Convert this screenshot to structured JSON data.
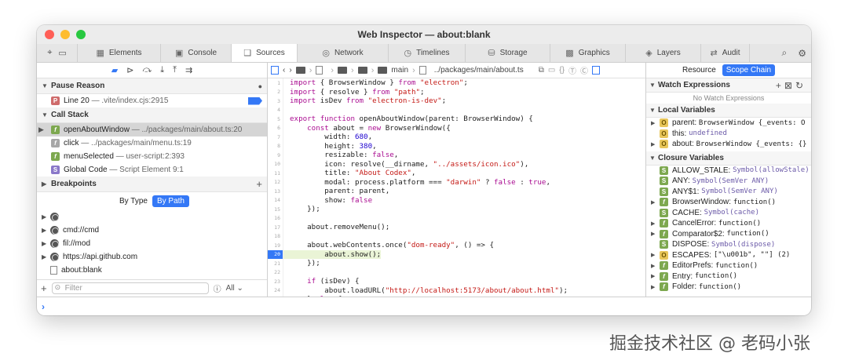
{
  "window": {
    "title": "Web Inspector — about:blank",
    "light_colors": [
      "#ff5f57",
      "#febc2e",
      "#28c840"
    ]
  },
  "tabs": [
    {
      "label": "Elements",
      "icon": "elements-icon",
      "glyph": "▦",
      "w": 106
    },
    {
      "label": "Console",
      "icon": "console-icon",
      "glyph": "▣",
      "w": 90
    },
    {
      "label": "Sources",
      "icon": "sources-icon",
      "glyph": "❑",
      "w": 84,
      "active": true
    },
    {
      "label": "Network",
      "icon": "network-icon",
      "glyph": "◎",
      "w": 116
    },
    {
      "label": "Timelines",
      "icon": "timelines-icon",
      "glyph": "◷",
      "w": 98
    },
    {
      "label": "Storage",
      "icon": "storage-icon",
      "glyph": "⛁",
      "w": 108
    },
    {
      "label": "Graphics",
      "icon": "graphics-icon",
      "glyph": "▩",
      "w": 96
    },
    {
      "label": "Layers",
      "icon": "layers-icon",
      "glyph": "◈",
      "w": 96
    },
    {
      "label": "Audit",
      "icon": "audit-icon",
      "glyph": "⇄",
      "w": 62
    }
  ],
  "left": {
    "pause_reason": {
      "title": "Pause Reason",
      "line": "Line 20",
      "file": "— .vite/index.cjs:2915"
    },
    "call_stack": {
      "title": "Call Stack",
      "frames": [
        {
          "name": "openAboutWindow",
          "loc": "— ../packages/main/about.ts:20",
          "badge": "f",
          "kind": "b-fn"
        },
        {
          "name": "click",
          "loc": "— ../packages/main/menu.ts:19",
          "badge": "f",
          "kind": "b-fn-grey"
        },
        {
          "name": "menuSelected",
          "loc": "— user-script:2:393",
          "badge": "f",
          "kind": "b-fn"
        },
        {
          "name": "Global Code",
          "loc": "— Script Element 9:1",
          "badge": "S",
          "kind": "b-s"
        }
      ]
    },
    "breakpoints": {
      "title": "Breakpoints",
      "by_type": "By Type",
      "by_path": "By Path",
      "items": [
        {
          "label": "",
          "kind": "globe"
        },
        {
          "label": "cmd://cmd",
          "kind": "globe"
        },
        {
          "label": "fil://mod",
          "kind": "globe"
        },
        {
          "label": "https://api.github.com",
          "kind": "globe"
        },
        {
          "label": "about:blank",
          "kind": "doc"
        }
      ]
    },
    "filter": {
      "placeholder": "Filter",
      "scope": "All"
    }
  },
  "breadcrumbs": {
    "items": [
      "main",
      "../packages/main/about.ts"
    ]
  },
  "code": {
    "lines": [
      {
        "n": "1",
        "t": "import { BrowserWindow } from \"electron\";"
      },
      {
        "n": "2",
        "t": "import { resolve } from \"path\";"
      },
      {
        "n": "3",
        "t": "import isDev from \"electron-is-dev\";"
      },
      {
        "n": "4",
        "t": ""
      },
      {
        "n": "5",
        "t": "export function openAboutWindow(parent: BrowserWindow) {"
      },
      {
        "n": "6",
        "t": "    const about = new BrowserWindow({"
      },
      {
        "n": "7",
        "t": "        width: 680,"
      },
      {
        "n": "8",
        "t": "        height: 380,"
      },
      {
        "n": "9",
        "t": "        resizable: false,"
      },
      {
        "n": "10",
        "t": "        icon: resolve(__dirname, \"../assets/icon.ico\"),"
      },
      {
        "n": "11",
        "t": "        title: \"About Codex\","
      },
      {
        "n": "12",
        "t": "        modal: process.platform === \"darwin\" ? false : true,"
      },
      {
        "n": "13",
        "t": "        parent: parent,"
      },
      {
        "n": "14",
        "t": "        show: false"
      },
      {
        "n": "15",
        "t": "    });"
      },
      {
        "n": "16",
        "t": ""
      },
      {
        "n": "17",
        "t": "    about.removeMenu();"
      },
      {
        "n": "18",
        "t": ""
      },
      {
        "n": "19",
        "t": "    about.webContents.once(\"dom-ready\", () => {"
      },
      {
        "n": "20",
        "t": "        about.show();",
        "exec": true
      },
      {
        "n": "21",
        "t": "    });"
      },
      {
        "n": "22",
        "t": ""
      },
      {
        "n": "23",
        "t": "    if (isDev) {"
      },
      {
        "n": "24",
        "t": "        about.loadURL(\"http://localhost:5173/about/about.html\");"
      },
      {
        "n": "25",
        "t": "    } else {"
      }
    ]
  },
  "right": {
    "resource": "Resource",
    "scope_chain": "Scope Chain",
    "watch": {
      "title": "Watch Expressions",
      "empty": "No Watch Expressions"
    },
    "local": {
      "title": "Local Variables",
      "rows": [
        {
          "badge": "O",
          "kind": "b-o",
          "name": "parent:",
          "val": "BrowserWindow {_events: O",
          "tri": true
        },
        {
          "badge": "O",
          "kind": "b-o",
          "name": "this:",
          "val": "undefined",
          "tri": false
        },
        {
          "badge": "O",
          "kind": "b-o",
          "name": "about:",
          "val": "BrowserWindow {_events: {}",
          "tri": true
        }
      ]
    },
    "closure": {
      "title": "Closure Variables",
      "rows": [
        {
          "badge": "S",
          "kind": "b-class",
          "name": "ALLOW_STALE:",
          "val": "Symbol(allowStale)",
          "tri": false
        },
        {
          "badge": "S",
          "kind": "b-class",
          "name": "ANY:",
          "val": "Symbol(SemVer ANY)",
          "tri": false
        },
        {
          "badge": "S",
          "kind": "b-class",
          "name": "ANY$1:",
          "val": "Symbol(SemVer ANY)",
          "tri": false
        },
        {
          "badge": "f",
          "kind": "b-fn",
          "name": "BrowserWindow:",
          "val": "function()",
          "tri": true
        },
        {
          "badge": "S",
          "kind": "b-class",
          "name": "CACHE:",
          "val": "Symbol(cache)",
          "tri": false
        },
        {
          "badge": "f",
          "kind": "b-fn",
          "name": "CancelError:",
          "val": "function()",
          "tri": true
        },
        {
          "badge": "f",
          "kind": "b-fn",
          "name": "Comparator$2:",
          "val": "function()",
          "tri": true
        },
        {
          "badge": "S",
          "kind": "b-class",
          "name": "DISPOSE:",
          "val": "Symbol(dispose)",
          "tri": false
        },
        {
          "badge": "O",
          "kind": "b-o",
          "name": "ESCAPES:",
          "val": "[\"\\u001b\", \"\"] (2)",
          "tri": true
        },
        {
          "badge": "f",
          "kind": "b-fn",
          "name": "EditorPrefs:",
          "val": "function()",
          "tri": true
        },
        {
          "badge": "f",
          "kind": "b-fn",
          "name": "Entry:",
          "val": "function()",
          "tri": true
        },
        {
          "badge": "f",
          "kind": "b-fn",
          "name": "Folder:",
          "val": "function()",
          "tri": true
        }
      ]
    }
  },
  "watermark": "掘金技术社区 @ 老码小张"
}
